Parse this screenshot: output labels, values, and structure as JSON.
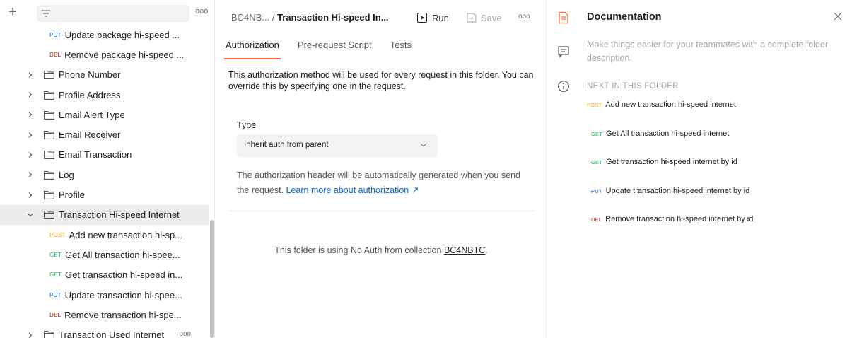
{
  "sidebar": {
    "more_label": "ooo",
    "items": [
      {
        "kind": "request",
        "method": "PUT",
        "label": "Update package hi-speed ..."
      },
      {
        "kind": "request",
        "method": "DEL",
        "label": "Remove package hi-speed ..."
      },
      {
        "kind": "folder",
        "label": "Phone Number",
        "expanded": false
      },
      {
        "kind": "folder",
        "label": "Profile Address",
        "expanded": false
      },
      {
        "kind": "folder",
        "label": "Email Alert Type",
        "expanded": false
      },
      {
        "kind": "folder",
        "label": "Email Receiver",
        "expanded": false
      },
      {
        "kind": "folder",
        "label": "Email Transaction",
        "expanded": false
      },
      {
        "kind": "folder",
        "label": "Log",
        "expanded": false
      },
      {
        "kind": "folder",
        "label": "Profile",
        "expanded": false
      },
      {
        "kind": "folder",
        "label": "Transaction Hi-speed Internet",
        "expanded": true,
        "selected": true
      },
      {
        "kind": "request",
        "method": "POST",
        "label": "Add new transaction hi-sp..."
      },
      {
        "kind": "request",
        "method": "GET",
        "label": "Get All transaction hi-spee..."
      },
      {
        "kind": "request",
        "method": "GET",
        "label": "Get transaction hi-speed in..."
      },
      {
        "kind": "request",
        "method": "PUT",
        "label": "Update transaction hi-spee..."
      },
      {
        "kind": "request",
        "method": "DEL",
        "label": "Remove transaction hi-spe..."
      },
      {
        "kind": "folder",
        "label": "Transaction Used Internet",
        "expanded": false,
        "more": "ooo"
      }
    ]
  },
  "header": {
    "collection": "BC4NB...",
    "separator": "/",
    "folder": "Transaction Hi-speed In...",
    "run_label": "Run",
    "save_label": "Save",
    "more_label": "ooo"
  },
  "tabs": [
    {
      "label": "Authorization",
      "active": true
    },
    {
      "label": "Pre-request Script",
      "active": false
    },
    {
      "label": "Tests",
      "active": false
    }
  ],
  "auth": {
    "description": "This authorization method will be used for every request in this folder. You can override this by specifying one in the request.",
    "type_label": "Type",
    "type_value": "Inherit auth from parent",
    "note_prefix": "The authorization header will be automatically generated when you send the request.",
    "note_link": "Learn more about authorization ↗",
    "noauth_prefix": "This folder is using No Auth from collection",
    "noauth_collection": "BC4NBTC",
    "noauth_suffix": "."
  },
  "documentation": {
    "title": "Documentation",
    "description": "Make things easier for your teammates with a complete folder description.",
    "next_title": "NEXT IN THIS FOLDER",
    "next_items": [
      {
        "method": "POST",
        "label": "Add new transaction hi-speed internet"
      },
      {
        "method": "GET",
        "label": "Get All transaction hi-speed internet"
      },
      {
        "method": "GET",
        "label": "Get transaction hi-speed internet by id"
      },
      {
        "method": "PUT",
        "label": "Update transaction hi-speed internet by id"
      },
      {
        "method": "DEL",
        "label": "Remove transaction hi-speed internet by id"
      }
    ]
  },
  "colors": {
    "accent": "#ff6c37",
    "get": "#0cbb52",
    "post": "#ffa700",
    "put": "#0265d2",
    "del": "#b4231b",
    "link": "#0265d2"
  },
  "icons": {
    "add": "plus-icon",
    "filter": "filter-icon",
    "folder": "folder-icon",
    "run": "play-icon",
    "save": "save-icon",
    "docs": "document-icon",
    "comments": "comment-icon",
    "info": "info-icon",
    "close": "close-icon"
  }
}
